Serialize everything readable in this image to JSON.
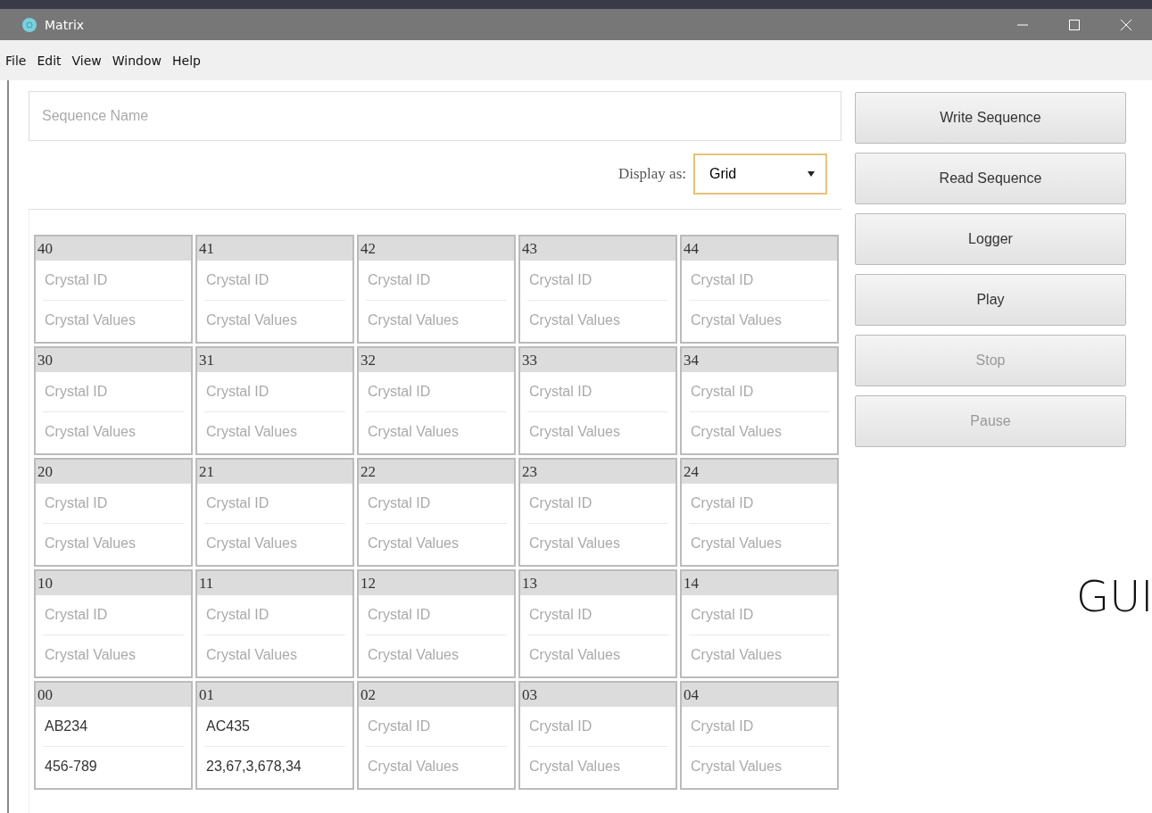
{
  "window": {
    "title": "Matrix"
  },
  "menu": [
    "File",
    "Edit",
    "View",
    "Window",
    "Help"
  ],
  "sequence_name": {
    "placeholder": "Sequence Name"
  },
  "display": {
    "label": "Display as:",
    "value": "Grid"
  },
  "grid": [
    [
      {
        "label": "40",
        "fields": [
          {
            "placeholder": "Crystal ID"
          },
          {
            "placeholder": "Crystal Values"
          }
        ]
      },
      {
        "label": "41",
        "fields": [
          {
            "placeholder": "Crystal ID"
          },
          {
            "placeholder": "Crystal Values"
          }
        ]
      },
      {
        "label": "42",
        "fields": [
          {
            "placeholder": "Crystal ID"
          },
          {
            "placeholder": "Crystal Values"
          }
        ]
      },
      {
        "label": "43",
        "fields": [
          {
            "placeholder": "Crystal ID"
          },
          {
            "placeholder": "Crystal Values"
          }
        ]
      },
      {
        "label": "44",
        "fields": [
          {
            "placeholder": "Crystal ID"
          },
          {
            "placeholder": "Crystal Values"
          }
        ]
      }
    ],
    [
      {
        "label": "30",
        "fields": [
          {
            "placeholder": "Crystal ID"
          },
          {
            "placeholder": "Crystal Values"
          }
        ]
      },
      {
        "label": "31",
        "fields": [
          {
            "placeholder": "Crystal ID"
          },
          {
            "placeholder": "Crystal Values"
          }
        ]
      },
      {
        "label": "32",
        "fields": [
          {
            "placeholder": "Crystal ID"
          },
          {
            "placeholder": "Crystal Values"
          }
        ]
      },
      {
        "label": "33",
        "fields": [
          {
            "placeholder": "Crystal ID"
          },
          {
            "placeholder": "Crystal Values"
          }
        ]
      },
      {
        "label": "34",
        "fields": [
          {
            "placeholder": "Crystal ID"
          },
          {
            "placeholder": "Crystal Values"
          }
        ]
      }
    ],
    [
      {
        "label": "20",
        "fields": [
          {
            "placeholder": "Crystal ID"
          },
          {
            "placeholder": "Crystal Values"
          }
        ]
      },
      {
        "label": "21",
        "fields": [
          {
            "placeholder": "Crystal ID"
          },
          {
            "placeholder": "Crystal Values"
          }
        ]
      },
      {
        "label": "22",
        "fields": [
          {
            "placeholder": "Crystal ID"
          },
          {
            "placeholder": "Crystal Values"
          }
        ]
      },
      {
        "label": "23",
        "fields": [
          {
            "placeholder": "Crystal ID"
          },
          {
            "placeholder": "Crystal Values"
          }
        ]
      },
      {
        "label": "24",
        "fields": [
          {
            "placeholder": "Crystal ID"
          },
          {
            "placeholder": "Crystal Values"
          }
        ]
      }
    ],
    [
      {
        "label": "10",
        "fields": [
          {
            "placeholder": "Crystal ID"
          },
          {
            "placeholder": "Crystal Values"
          }
        ]
      },
      {
        "label": "11",
        "fields": [
          {
            "placeholder": "Crystal ID"
          },
          {
            "placeholder": "Crystal Values"
          }
        ]
      },
      {
        "label": "12",
        "fields": [
          {
            "placeholder": "Crystal ID"
          },
          {
            "placeholder": "Crystal Values"
          }
        ]
      },
      {
        "label": "13",
        "fields": [
          {
            "placeholder": "Crystal ID"
          },
          {
            "placeholder": "Crystal Values"
          }
        ]
      },
      {
        "label": "14",
        "fields": [
          {
            "placeholder": "Crystal ID"
          },
          {
            "placeholder": "Crystal Values"
          }
        ]
      }
    ],
    [
      {
        "label": "00",
        "fields": [
          {
            "value": "AB234"
          },
          {
            "value": "456-789"
          }
        ]
      },
      {
        "label": "01",
        "fields": [
          {
            "value": "AC435"
          },
          {
            "value": "23,67,3,678,34"
          }
        ]
      },
      {
        "label": "02",
        "fields": [
          {
            "placeholder": "Crystal ID"
          },
          {
            "placeholder": "Crystal Values"
          }
        ]
      },
      {
        "label": "03",
        "fields": [
          {
            "placeholder": "Crystal ID"
          },
          {
            "placeholder": "Crystal Values"
          }
        ]
      },
      {
        "label": "04",
        "fields": [
          {
            "placeholder": "Crystal ID"
          },
          {
            "placeholder": "Crystal Values"
          }
        ]
      }
    ]
  ],
  "buttons": [
    {
      "label": "Write Sequence",
      "disabled": false
    },
    {
      "label": "Read Sequence",
      "disabled": false
    },
    {
      "label": "Logger",
      "disabled": false
    },
    {
      "label": "Play",
      "disabled": false
    },
    {
      "label": "Stop",
      "disabled": true
    },
    {
      "label": "Pause",
      "disabled": true
    }
  ],
  "caption": "GUI"
}
